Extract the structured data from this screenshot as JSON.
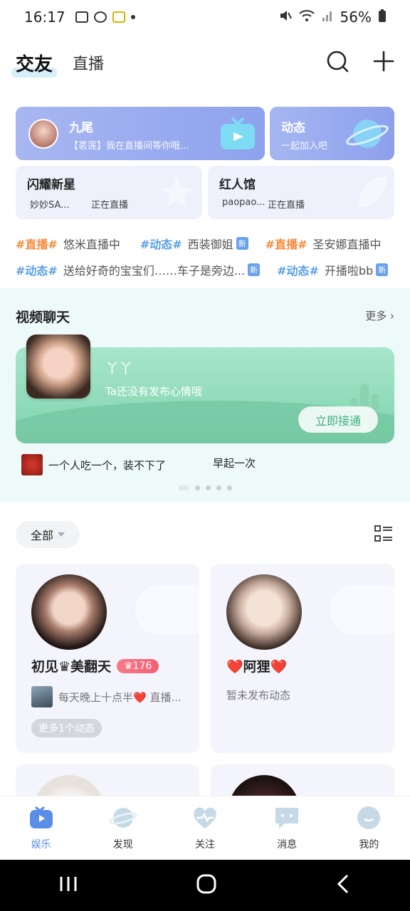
{
  "status_bar": {
    "time": "16:17",
    "battery": "56%"
  },
  "header": {
    "tabs": [
      {
        "label": "交友"
      },
      {
        "label": "直播"
      }
    ]
  },
  "banners": {
    "live_card": {
      "title": "九尾",
      "subtitle": "【茗莲】我在直播间等你哦..."
    },
    "moments_card": {
      "title": "动态",
      "subtitle": "一起加入吧"
    },
    "shine_card": {
      "title": "闪耀新星",
      "name": "妙妙SA...",
      "status": "正在直播"
    },
    "red_card": {
      "title": "红人馆",
      "name": "paopao...",
      "status": "正在直播"
    }
  },
  "topics": {
    "row1": [
      {
        "tag": "#直播#",
        "text": "悠米直播中",
        "tone": "orange"
      },
      {
        "tag": "#动态#",
        "text": "西装御姐",
        "tone": "blue",
        "new": "新"
      },
      {
        "tag": "#直播#",
        "text": "圣安娜直播中",
        "tone": "orange"
      }
    ],
    "row2": [
      {
        "tag": "#动态#",
        "text": "送给好奇的宝宝们……车子是旁边...",
        "tone": "blue",
        "new": "新"
      },
      {
        "tag": "#动态#",
        "text": "开播啦bb",
        "tone": "blue",
        "new": "新"
      }
    ]
  },
  "video_chat": {
    "title": "视频聊天",
    "more": "更多",
    "name": "丫丫",
    "mood": "Ta还没有发布心情哦",
    "connect_button": "立即接通",
    "recent_1": "一个人吃一个，装不下了",
    "recent_2": "早起一次"
  },
  "filter": {
    "label": "全部"
  },
  "users": [
    {
      "name": "初见♛美翻天",
      "level": "♛176",
      "desc": "每天晚上十点半❤️ 直播...",
      "more": "更多1个动态"
    },
    {
      "name": "❤️阿狸❤️",
      "desc": "暂未发布动态"
    }
  ],
  "bottom_nav": [
    {
      "label": "娱乐",
      "active": true
    },
    {
      "label": "发现"
    },
    {
      "label": "关注"
    },
    {
      "label": "消息"
    },
    {
      "label": "我的"
    }
  ],
  "colors": {
    "accent_blue": "#5b8fe7",
    "tag_orange": "#f58a3b",
    "tag_blue": "#5a9ee6",
    "video_green": "#7fd3ad"
  }
}
